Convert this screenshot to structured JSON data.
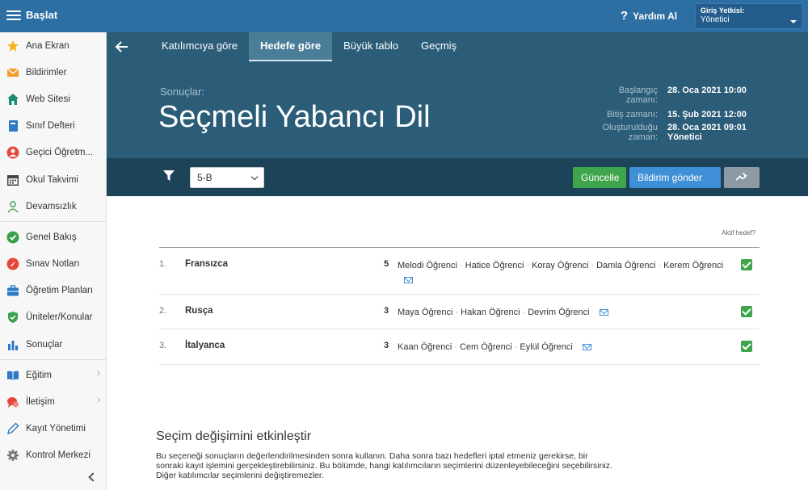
{
  "topbar": {
    "brand": "Başlat",
    "help_label": "Yardım Al",
    "role_label": "Giriş Yetkisi:",
    "role_value": "Yönetici"
  },
  "sidebar": {
    "items": [
      {
        "label": "Ana Ekran",
        "icon": "star-icon"
      },
      {
        "label": "Bildirimler",
        "icon": "envelope-icon"
      },
      {
        "label": "Web Sitesi",
        "icon": "home-icon"
      },
      {
        "label": "Sınıf Defteri",
        "icon": "notebook-icon"
      },
      {
        "label": "Geçici Öğretm...",
        "icon": "person-icon"
      },
      {
        "label": "Okul Takvimi",
        "icon": "calendar-icon"
      },
      {
        "label": "Devamsızlık",
        "icon": "user-outline-icon"
      },
      {
        "label": "Genel Bakış",
        "icon": "check-circle-icon"
      },
      {
        "label": "Sınav Notları",
        "icon": "grade-icon"
      },
      {
        "label": "Öğretim Planları",
        "icon": "briefcase-icon"
      },
      {
        "label": "Üniteler/Konular",
        "icon": "shield-check-icon"
      },
      {
        "label": "Sonuçlar",
        "icon": "bar-chart-icon"
      },
      {
        "label": "Eğitim",
        "icon": "book-icon"
      },
      {
        "label": "İletişim",
        "icon": "chat-icon"
      },
      {
        "label": "Kayıt Yönetimi",
        "icon": "pencil-icon"
      },
      {
        "label": "Kontrol Merkezi",
        "icon": "gear-icon"
      }
    ]
  },
  "header": {
    "tabs": [
      "Katılımcıya göre",
      "Hedefe göre",
      "Büyük tablo",
      "Geçmiş"
    ],
    "active_tab": "Hedefe göre",
    "subtitle": "Sonuçlar:",
    "title": "Seçmeli Yabancı Dil",
    "meta": [
      {
        "key": "Başlangıç zamanı:",
        "value": "28. Oca 2021 10:00"
      },
      {
        "key": "Bitiş zamanı:",
        "value": "15. Şub 2021 12:00"
      },
      {
        "key": "Oluşturulduğu zaman:",
        "value": "28. Oca 2021 09:01 Yönetici"
      }
    ]
  },
  "toolbar": {
    "class_select": "5-B",
    "update_label": "Güncelle",
    "notify_label": "Bildirim gönder"
  },
  "list": {
    "aktif_label": "Aktif hedef?",
    "rows": [
      {
        "num": "1.",
        "name": "Fransızca",
        "count": "5",
        "people": [
          "Melodi Öğrenci",
          "Hatice Öğrenci",
          "Koray Öğrenci",
          "Damla Öğrenci",
          "Kerem Öğrenci"
        ],
        "active": true
      },
      {
        "num": "2.",
        "name": "Rusça",
        "count": "3",
        "people": [
          "Maya Öğrenci",
          "Hakan Öğrenci",
          "Devrim Öğrenci"
        ],
        "active": true
      },
      {
        "num": "3.",
        "name": "İtalyanca",
        "count": "3",
        "people": [
          "Kaan Öğrenci",
          "Cem Öğrenci",
          "Eylül Öğrenci"
        ],
        "active": true
      }
    ]
  },
  "info": {
    "title": "Seçim değişimini etkinleştir",
    "text": "Bu seçeneği sonuçların değerlendirilmesinden sonra kullanın. Daha sonra bazı hedefleri iptal etmeniz gerekirse, bir sonraki kayıt işlemini gerçekleştirebilirsiniz. Bu bölümde, hangi katılımcıların seçimlerini düzenleyebileceğini seçebilirsiniz. Diğer katılımcılar seçimlerini değiştiremezler."
  },
  "colors": {
    "topbar": "#2d6ea3",
    "hero": "#2b5c78",
    "toolbar": "#1c4358",
    "green": "#3fa54a",
    "blue": "#3e8fd6"
  }
}
